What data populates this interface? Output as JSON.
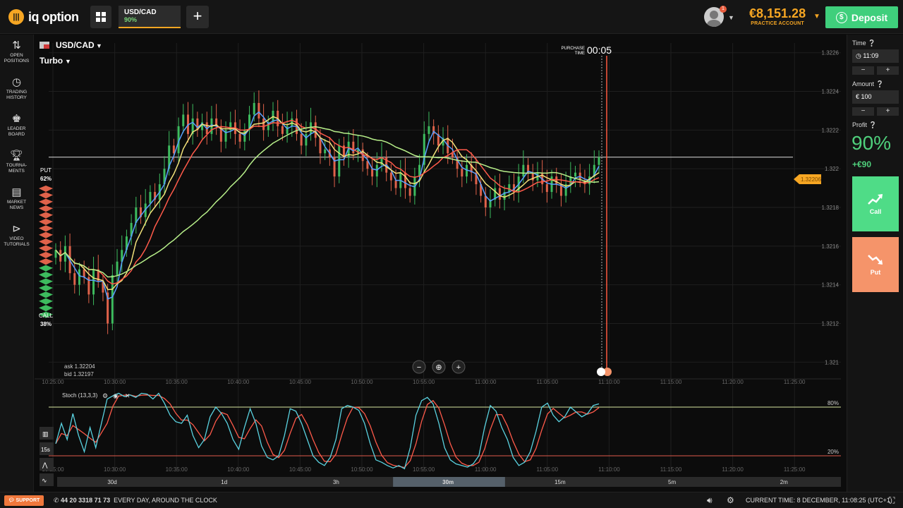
{
  "header": {
    "logo_text": "iq option",
    "asset_tab": {
      "name": "USD/CAD",
      "profit": "90%"
    },
    "add_label": "+",
    "notification_count": "1",
    "balance": "€8,151.28",
    "account_type": "PRACTICE ACCOUNT",
    "deposit_label": "Deposit"
  },
  "sidebar": {
    "items": [
      {
        "label": "OPEN\nPOSITIONS",
        "icon": "swap-arrows-icon"
      },
      {
        "label": "TRADING\nHISTORY",
        "icon": "history-clock-icon"
      },
      {
        "label": "LEADER\nBOARD",
        "icon": "leaderboard-icon"
      },
      {
        "label": "TOURNA-\nMENTS",
        "icon": "trophy-icon"
      },
      {
        "label": "MARKET\nNEWS",
        "icon": "news-icon"
      },
      {
        "label": "VIDEO\nTUTORIALS",
        "icon": "play-icon"
      }
    ]
  },
  "chart_area": {
    "asset": "USD/CAD",
    "mode": "Turbo",
    "purchase_label": "PURCHASE\nTIME",
    "countdown": "00:05",
    "current_price_label": "1.32206",
    "ask": "ask 1.32204",
    "bid": "bid 1.32197",
    "put_sentiment": {
      "label": "PUT",
      "value": "62%"
    },
    "call_sentiment": {
      "label": "CALL",
      "value": "38%"
    },
    "indicator_label": "Stoch (13,3,3)",
    "time_ticks": [
      "10:25:00",
      "10:30:00",
      "10:35:00",
      "10:40:00",
      "10:45:00",
      "10:50:00",
      "10:55:00",
      "11:00:00",
      "11:05:00",
      "11:10:00",
      "11:15:00",
      "11:20:00",
      "11:25:00"
    ],
    "price_ticks": [
      "1.3226",
      "1.3224",
      "1.3222",
      "1.322",
      "1.3218",
      "1.3216",
      "1.3214",
      "1.3212",
      "1.321"
    ],
    "stoch_levels": [
      "80%",
      "20%"
    ],
    "stoch_side": [
      "15s"
    ],
    "timescales": [
      "30d",
      "1d",
      "3h",
      "30m",
      "15m",
      "5m",
      "2m"
    ],
    "active_timescale": "30m",
    "colors": {
      "up": "#3dbb5e",
      "down": "#e0624a",
      "blue": "#5aa0ff",
      "yellow": "#f2e27a",
      "red": "#ff5a4a",
      "green": "#b8f08a",
      "cyan": "#5ad2e0"
    }
  },
  "chart_data": {
    "type": "candlestick",
    "xlabel": "",
    "ylabel": "",
    "xlim": [
      "10:25:00",
      "11:27:00"
    ],
    "ylim": [
      1.32095,
      1.32265
    ],
    "current_price": 1.32206,
    "candles_close": [
      1.32158,
      1.32152,
      1.3216,
      1.32146,
      1.3214,
      1.32148,
      1.32144,
      1.32135,
      1.32148,
      1.32142,
      1.32136,
      1.3212,
      1.32145,
      1.32152,
      1.32158,
      1.32165,
      1.32172,
      1.3218,
      1.32175,
      1.32182,
      1.32188,
      1.32184,
      1.32192,
      1.322,
      1.32212,
      1.32208,
      1.32222,
      1.32228,
      1.32218,
      1.32226,
      1.3222,
      1.32224,
      1.32218,
      1.32226,
      1.32222,
      1.32214,
      1.3222,
      1.32224,
      1.32218,
      1.32214,
      1.3222,
      1.32228,
      1.32234,
      1.32226,
      1.3222,
      1.32224,
      1.3223,
      1.32222,
      1.32218,
      1.32222,
      1.32226,
      1.32218,
      1.32212,
      1.32218,
      1.32224,
      1.32216,
      1.32208,
      1.3221,
      1.32206,
      1.32196,
      1.32212,
      1.32206,
      1.32214,
      1.32208,
      1.3221,
      1.32204,
      1.322,
      1.32196,
      1.32202,
      1.32206,
      1.32198,
      1.32194,
      1.3219,
      1.32198,
      1.3219,
      1.32186,
      1.32196,
      1.32202,
      1.32218,
      1.32222,
      1.32218,
      1.32212,
      1.32216,
      1.32208,
      1.32206,
      1.322,
      1.32196,
      1.32202,
      1.32198,
      1.32192,
      1.32186,
      1.3218,
      1.32184,
      1.3219,
      1.32184,
      1.32188,
      1.32192,
      1.32188,
      1.32196,
      1.32202,
      1.32198,
      1.32194,
      1.32198,
      1.32192,
      1.32188,
      1.32196,
      1.32192,
      1.32186,
      1.32192,
      1.32196,
      1.32198,
      1.32194,
      1.32192,
      1.32196,
      1.32202,
      1.32206
    ],
    "stoch_k": [
      35,
      60,
      40,
      72,
      45,
      25,
      55,
      30,
      60,
      90,
      94,
      97,
      93,
      95,
      92,
      97,
      96,
      90,
      97,
      85,
      70,
      62,
      60,
      70,
      45,
      30,
      40,
      68,
      80,
      72,
      60,
      40,
      28,
      55,
      78,
      60,
      32,
      18,
      15,
      20,
      45,
      78,
      75,
      60,
      40,
      20,
      12,
      8,
      18,
      40,
      78,
      82,
      80,
      76,
      60,
      35,
      15,
      12,
      8,
      5,
      8,
      4,
      30,
      70,
      88,
      92,
      84,
      60,
      30,
      15,
      10,
      8,
      6,
      10,
      20,
      55,
      82,
      75,
      55,
      40,
      18,
      8,
      12,
      25,
      50,
      80,
      85,
      70,
      62,
      68,
      80,
      74,
      68,
      72,
      82,
      84
    ]
  },
  "right_panel": {
    "time_label": "Time",
    "time_value": "11:09",
    "amount_label": "Amount",
    "amount_value": "€  100",
    "profit_label": "Profit",
    "profit_pct": "90%",
    "profit_amount": "+€90",
    "minus": "−",
    "plus": "+",
    "call_label": "Call",
    "put_label": "Put"
  },
  "footer": {
    "support_label": "SUPPORT",
    "phone": "44 20 3318 71 73",
    "phone_note": "EVERY DAY, AROUND THE CLOCK",
    "current_time": "CURRENT TIME: 8 DECEMBER, 11:08:25 (UTC+1)"
  }
}
